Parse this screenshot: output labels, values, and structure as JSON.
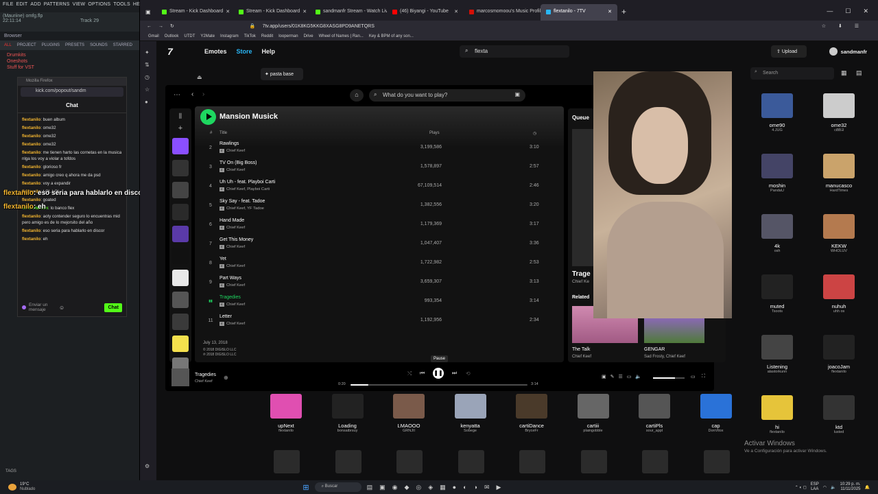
{
  "daw": {
    "menu": [
      "FILE",
      "EDIT",
      "ADD",
      "PATTERNS",
      "VIEW",
      "OPTIONS",
      "TOOLS",
      "HELP"
    ],
    "project_file": "(Mauriine) omfg.flp",
    "time": "22:11:14",
    "track_label": "Track 29",
    "browser_tabs": [
      "ALL",
      "PROJECT",
      "PLUGINS",
      "PRESETS",
      "SOUNDS",
      "STARRED"
    ],
    "browser_label": "Browser",
    "browser_items": [
      "Drumkits",
      "Oneshots",
      "Stuff for VST"
    ],
    "tags_label": "TAGS"
  },
  "popout": {
    "window_title": "Mozilla Firefox",
    "url": "kick.com/popout/sandm",
    "chat_title": "Chat",
    "messages": [
      {
        "user": "flextanilo",
        "text": "buen album",
        "green": false
      },
      {
        "user": "flextanilo",
        "text": "ome32",
        "green": false
      },
      {
        "user": "flextanilo",
        "text": "ome32",
        "green": false
      },
      {
        "user": "flextanilo",
        "text": "ome32",
        "green": false
      },
      {
        "user": "flextanilo",
        "text": "me tienen harto las cornetas en la musica nlga los voy a violar a tofdos",
        "green": false
      },
      {
        "user": "flextanilo",
        "text": "glorioso fr",
        "green": false
      },
      {
        "user": "flextanilo",
        "text": "amigo creo q ahora me da psd",
        "green": false
      },
      {
        "user": "flextanilo",
        "text": "voy a expandir",
        "green": false
      },
      {
        "user": "flextanilo",
        "text": "LOL LOL",
        "green": false
      },
      {
        "user": "flextanilo",
        "text": "goated",
        "green": false
      },
      {
        "user": "killthedemon",
        "text": "lo banco flex",
        "green": true
      },
      {
        "user": "flextanilo",
        "text": "aoty contender seguro lo encuentras mid pero amigo es de lo mejorsito del año",
        "green": false
      },
      {
        "user": "flextanilo",
        "text": "eso seria para hablarlo en discor",
        "green": false
      },
      {
        "user": "flextanilo",
        "text": "eh",
        "green": false
      }
    ],
    "input_placeholder": "Enviar un mensaje",
    "chat_button": "Chat"
  },
  "overlay": [
    {
      "user": "flextanilo",
      "text": ": eso seria para hablarlo en discor"
    },
    {
      "user": "flextanilo",
      "text": ": eh"
    }
  ],
  "browser": {
    "tabs": [
      {
        "title": "Stream - Kick Dashboard",
        "color": "#53fc18",
        "active": false
      },
      {
        "title": "Stream - Kick Dashboard",
        "color": "#53fc18",
        "active": false
      },
      {
        "title": "sandmanfr Stream - Watch Live",
        "color": "#53fc18",
        "active": false
      },
      {
        "title": "(46) Biyangi - YouTube",
        "color": "#ff0000",
        "active": false
      },
      {
        "title": "marcosmomoou's Music Profile",
        "color": "#d51007",
        "active": false
      },
      {
        "title": "flextanilo - 7TV",
        "color": "#29b6f6",
        "active": true
      }
    ],
    "url": "7tv.app/users/01K8KG5KKG8XASG8PD9ANETQRS",
    "bookmarks": [
      "Gmail",
      "Outlook",
      "UTDT",
      "Y2Mate",
      "Instagram",
      "TikTok",
      "Reddit",
      "looperman",
      "Drive",
      "Wheel of Names | Ran...",
      "Key & BPM of any son..."
    ]
  },
  "seventv": {
    "logo": "7",
    "nav": [
      "Emotes",
      "Store",
      "Help"
    ],
    "search_value": "flexta",
    "upload_label": "Upload",
    "username": "sandmanfr",
    "pasta_label": "pasta base",
    "emote_search_placeholder": "Search"
  },
  "spotify": {
    "search_placeholder": "What do you want to play?",
    "playlist_title": "Mansion Musick",
    "headers": {
      "num": "#",
      "title": "Title",
      "plays": "Plays"
    },
    "tracks": [
      {
        "num": "2",
        "title": "Rawlings",
        "artist": "Chief Keef",
        "plays": "3,199,586",
        "dur": "3:10"
      },
      {
        "num": "3",
        "title": "TV On (Big Boss)",
        "artist": "Chief Keef",
        "plays": "1,578,897",
        "dur": "2:57"
      },
      {
        "num": "4",
        "title": "Uh Uh - feat. Playboi Carti",
        "artist": "Chief Keef, Playboi Carti",
        "plays": "67,109,514",
        "dur": "2:46"
      },
      {
        "num": "5",
        "title": "Sky Say - feat. Tadoe",
        "artist": "Chief Keef, YF Tadoe",
        "plays": "1,382,556",
        "dur": "3:20"
      },
      {
        "num": "6",
        "title": "Hand Made",
        "artist": "Chief Keef",
        "plays": "1,179,369",
        "dur": "3:17"
      },
      {
        "num": "7",
        "title": "Get This Money",
        "artist": "Chief Keef",
        "plays": "1,047,407",
        "dur": "3:36"
      },
      {
        "num": "8",
        "title": "Yet",
        "artist": "Chief Keef",
        "plays": "1,722,982",
        "dur": "2:53"
      },
      {
        "num": "9",
        "title": "Part Ways",
        "artist": "Chief Keef",
        "plays": "3,659,307",
        "dur": "3:13"
      },
      {
        "num": "",
        "title": "Tragedies",
        "artist": "Chief Keef",
        "plays": "993,354",
        "dur": "3:14"
      },
      {
        "num": "11",
        "title": "Letter",
        "artist": "Chief Keef",
        "plays": "1,192,956",
        "dur": "2:34"
      }
    ],
    "release_date": "July 13, 2018",
    "copyright1": "© 2018 DIGISLO LLC",
    "copyright2": "℗ 2018 DIGISLO LLC",
    "queue_title": "Queue",
    "queue_now_title": "Trage",
    "queue_now_artist": "Chief Ke",
    "related_label": "Related",
    "related": [
      {
        "title": "The Talk",
        "artist": "Chief Keef"
      },
      {
        "title": "GENGAR",
        "artist": "Sad Frosty, Chief Keef"
      }
    ],
    "now_playing_title": "Tragedies",
    "now_playing_artist": "Chief Keef",
    "tooltip": "Pause",
    "time_elapsed": "0:20",
    "time_total": "3:14",
    "progress": 0.1
  },
  "emotes_right": [
    {
      "name": "ome90",
      "by": "4.JUG"
    },
    {
      "name": "ome32",
      "by": "ciƃƃƎ"
    },
    {
      "name": "moshin",
      "by": "PandaU"
    },
    {
      "name": "manucasco",
      "by": "HardTimes"
    },
    {
      "name": "4k",
      "by": "osh"
    },
    {
      "name": "KEKW",
      "by": "WHOLUV"
    },
    {
      "name": "muted",
      "by": "Tsoots"
    },
    {
      "name": "nuhuh",
      "by": "uhh os"
    },
    {
      "name": "Listening",
      "by": "alastorkunn"
    },
    {
      "name": "joacoJam",
      "by": "flextanilo"
    },
    {
      "name": "hi",
      "by": "flextanilo"
    },
    {
      "name": "ktd",
      "by": "lusted"
    }
  ],
  "emotes_bottom": [
    {
      "name": "upNext",
      "by": "flextanilo"
    },
    {
      "name": "Loading",
      "by": "bonsaibrsuy"
    },
    {
      "name": "LMAOOO",
      "by": "GRNJII"
    },
    {
      "name": "kenyatta",
      "by": "Sobege"
    },
    {
      "name": "cartiDance",
      "by": "BryceFr"
    },
    {
      "name": "cartiii",
      "by": "plaingobble"
    },
    {
      "name": "cartiPls",
      "by": "sour_appl"
    },
    {
      "name": "cap",
      "by": "DonVilox"
    }
  ],
  "watermark": {
    "line1": "Activar Windows",
    "line2": "Ve a Configuración para activar Windows."
  },
  "taskbar": {
    "weather_temp": "19°C",
    "weather_text": "Nublado",
    "search": "Buscar",
    "lang1": "ESP",
    "lang2": "LAA",
    "time": "10:29 p. m.",
    "date": "11/11/2025"
  }
}
